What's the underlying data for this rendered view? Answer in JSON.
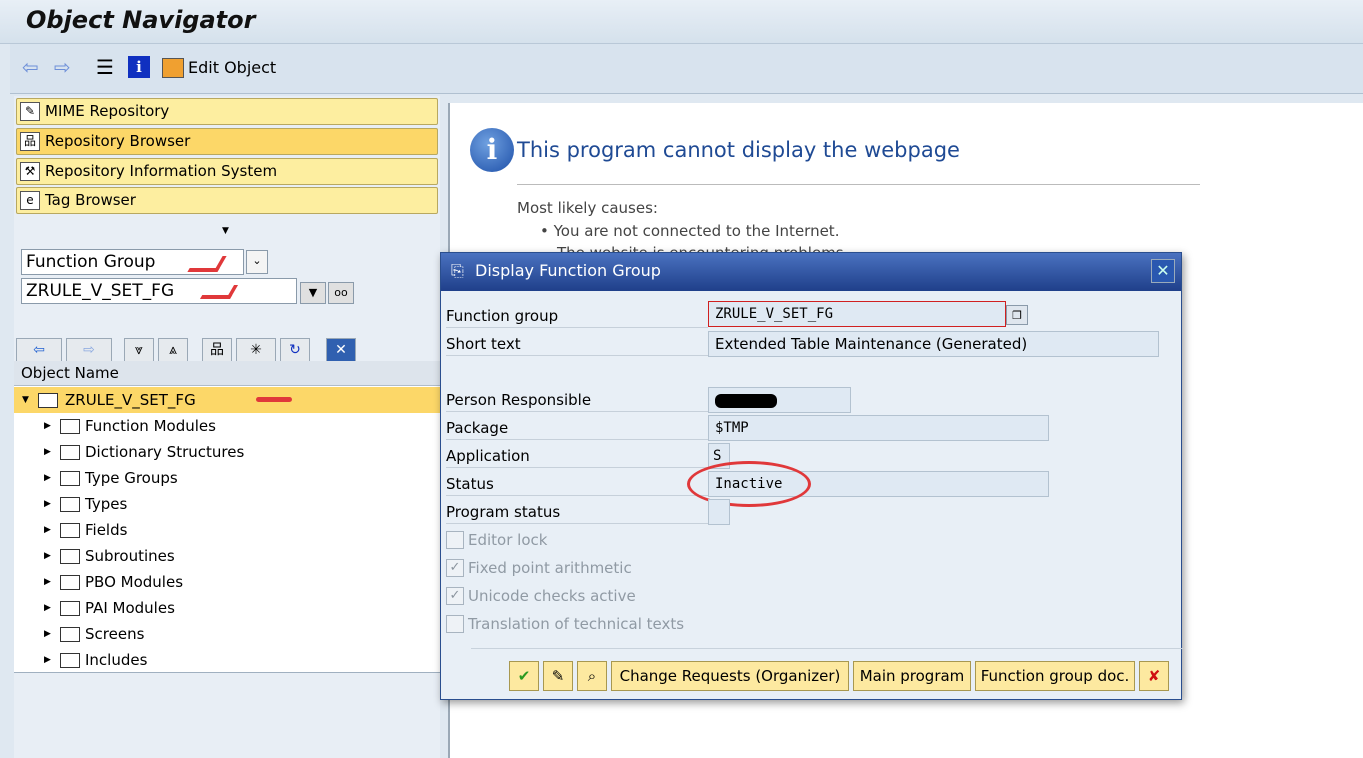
{
  "app": {
    "title": "Object Navigator"
  },
  "toolbar": {
    "back_icon": "arrow-left-icon",
    "forward_icon": "arrow-right-icon",
    "edit_object": "Edit Object"
  },
  "nav": {
    "items": [
      {
        "label": "MIME Repository"
      },
      {
        "label": "Repository Browser"
      },
      {
        "label": "Repository Information System"
      },
      {
        "label": "Tag Browser"
      }
    ]
  },
  "selection": {
    "object_type": "Function Group",
    "object_name": "ZRULE_V_SET_FG"
  },
  "tree": {
    "header": "Object Name",
    "root": "ZRULE_V_SET_FG",
    "children": [
      "Function Modules",
      "Dictionary Structures",
      "Type Groups",
      "Types",
      "Fields",
      "Subroutines",
      "PBO Modules",
      "PAI Modules",
      "Screens",
      "Includes"
    ]
  },
  "browser": {
    "title": "This program cannot display the webpage",
    "causes_label": "Most likely causes:",
    "causes": [
      "You are not connected to the Internet.",
      "The website is encountering problems."
    ]
  },
  "dialog": {
    "title": "Display Function Group",
    "fields": {
      "function_group_label": "Function group",
      "function_group": "ZRULE_V_SET_FG",
      "short_text_label": "Short text",
      "short_text": "Extended Table Maintenance (Generated)",
      "person_label": "Person Responsible",
      "package_label": "Package",
      "package": "$TMP",
      "application_label": "Application",
      "application": "S",
      "status_label": "Status",
      "status": "Inactive",
      "program_status_label": "Program status",
      "program_status": ""
    },
    "checks": [
      {
        "label": "Editor lock",
        "checked": false
      },
      {
        "label": "Fixed point arithmetic",
        "checked": true
      },
      {
        "label": "Unicode checks active",
        "checked": true
      },
      {
        "label": "Translation of technical texts",
        "checked": false
      }
    ],
    "buttons": {
      "change_requests": "Change Requests (Organizer)",
      "main_program": "Main program",
      "fg_doc": "Function group doc."
    }
  }
}
